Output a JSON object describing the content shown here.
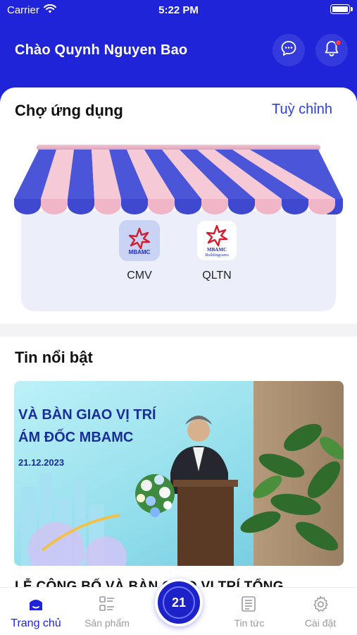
{
  "status_bar": {
    "carrier": "Carrier",
    "time": "5:22 PM"
  },
  "header": {
    "greeting": "Chào Quynh Nguyen Bao",
    "notification_dot": true
  },
  "market": {
    "title": "Chợ ứng dụng",
    "customize_label": "Tuỳ chỉnh",
    "apps": [
      {
        "label": "CMV",
        "logo_text": "MBAMC"
      },
      {
        "label": "QLTN",
        "logo_text": "MBAMC",
        "logo_subtext": "Buildingcares"
      }
    ]
  },
  "news": {
    "title": "Tin nổi bật",
    "image_banner_line1": "VÀ BÀN GIAO VỊ TRÍ",
    "image_banner_line2": "ÁM ĐỐC MBAMC",
    "image_banner_date": "21.12.2023",
    "headline": "LỄ CÔNG BỐ VÀ BÀN GIAO VỊ TRÍ TỔNG"
  },
  "tabbar": {
    "home": "Trang chủ",
    "products": "Sản phẩm",
    "center_badge": "21",
    "news": "Tin tức",
    "settings": "Cài đặt"
  },
  "colors": {
    "brand": "#1f24d8",
    "awning_blue": "#4a55d8",
    "awning_pink": "#f6c9d6",
    "accent_link": "#2b3fe0"
  }
}
